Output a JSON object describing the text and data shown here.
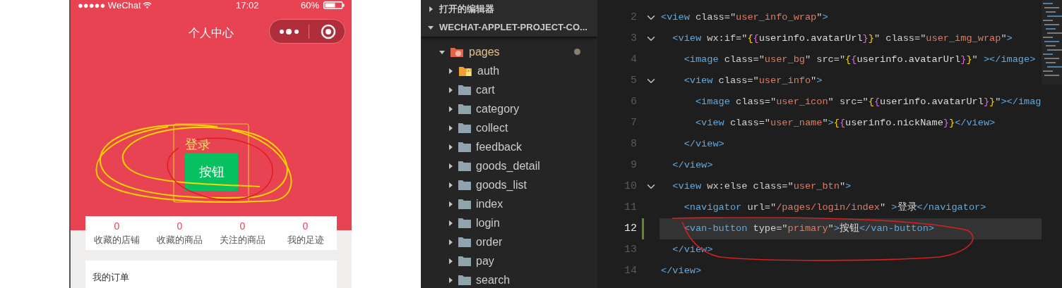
{
  "simulator": {
    "status_bar": {
      "carrier": "●●●●● WeChat",
      "time": "17:02",
      "battery": "60%"
    },
    "nav_title": "个人中心",
    "login_link": "登录",
    "button": "按钮",
    "stats": [
      {
        "value": "0",
        "label": "收藏的店铺"
      },
      {
        "value": "0",
        "label": "收藏的商品"
      },
      {
        "value": "0",
        "label": "关注的商品"
      },
      {
        "value": "0",
        "label": "我的足迹"
      }
    ],
    "orders_title": "我的订单"
  },
  "explorer": {
    "sections": [
      {
        "label": "打开的编辑器",
        "expanded": false
      },
      {
        "label": "WECHAT-APPLET-PROJECT-CO...",
        "expanded": true
      }
    ],
    "tree": [
      {
        "name": "pages",
        "kind": "special",
        "expanded": true,
        "modified": true,
        "children": [
          {
            "name": "auth",
            "kind": "locked",
            "expanded": false
          },
          {
            "name": "cart",
            "kind": "folder",
            "expanded": false
          },
          {
            "name": "category",
            "kind": "folder",
            "expanded": false
          },
          {
            "name": "collect",
            "kind": "folder",
            "expanded": false
          },
          {
            "name": "feedback",
            "kind": "folder",
            "expanded": false
          },
          {
            "name": "goods_detail",
            "kind": "folder",
            "expanded": false
          },
          {
            "name": "goods_list",
            "kind": "folder",
            "expanded": false
          },
          {
            "name": "index",
            "kind": "folder",
            "expanded": false
          },
          {
            "name": "login",
            "kind": "folder",
            "expanded": false
          },
          {
            "name": "order",
            "kind": "folder",
            "expanded": false
          },
          {
            "name": "pay",
            "kind": "folder",
            "expanded": false
          },
          {
            "name": "search",
            "kind": "folder",
            "expanded": false
          }
        ]
      }
    ]
  },
  "editor": {
    "lines": [
      {
        "number": "2",
        "foldable": true,
        "current": false,
        "tokens": [
          {
            "kind": "tag",
            "text": "<view"
          },
          {
            "kind": "attr",
            "text": " class=\""
          },
          {
            "kind": "string",
            "text": "user_info_wrap"
          },
          {
            "kind": "attr",
            "text": "\""
          },
          {
            "kind": "tag",
            "text": ">"
          }
        ]
      },
      {
        "number": "3",
        "foldable": true,
        "current": false,
        "tokens": [
          {
            "kind": "tag",
            "text": "  <view"
          },
          {
            "kind": "attr",
            "text": " wx:if=\""
          },
          {
            "kind": "brace1",
            "text": "{"
          },
          {
            "kind": "brace2",
            "text": "{"
          },
          {
            "kind": "text",
            "text": "userinfo.avatarUrl"
          },
          {
            "kind": "brace2",
            "text": "}"
          },
          {
            "kind": "brace1",
            "text": "}"
          },
          {
            "kind": "attr",
            "text": "\" class=\""
          },
          {
            "kind": "string",
            "text": "user_img_wrap"
          },
          {
            "kind": "attr",
            "text": "\""
          },
          {
            "kind": "tag",
            "text": ">"
          }
        ]
      },
      {
        "number": "4",
        "foldable": false,
        "current": false,
        "tokens": [
          {
            "kind": "tag",
            "text": "    <image"
          },
          {
            "kind": "attr",
            "text": " class=\""
          },
          {
            "kind": "string",
            "text": "user_bg"
          },
          {
            "kind": "attr",
            "text": "\" src=\""
          },
          {
            "kind": "brace1",
            "text": "{"
          },
          {
            "kind": "brace2",
            "text": "{"
          },
          {
            "kind": "text",
            "text": "userinfo.avatarUrl"
          },
          {
            "kind": "brace2",
            "text": "}"
          },
          {
            "kind": "brace1",
            "text": "}"
          },
          {
            "kind": "attr",
            "text": "\" "
          },
          {
            "kind": "tag",
            "text": "></image>"
          }
        ]
      },
      {
        "number": "5",
        "foldable": true,
        "current": false,
        "tokens": [
          {
            "kind": "tag",
            "text": "    <view"
          },
          {
            "kind": "attr",
            "text": " class=\""
          },
          {
            "kind": "string",
            "text": "user_info"
          },
          {
            "kind": "attr",
            "text": "\""
          },
          {
            "kind": "tag",
            "text": ">"
          }
        ]
      },
      {
        "number": "6",
        "foldable": false,
        "current": false,
        "tokens": [
          {
            "kind": "tag",
            "text": "      <image"
          },
          {
            "kind": "attr",
            "text": " class=\""
          },
          {
            "kind": "string",
            "text": "user_icon"
          },
          {
            "kind": "attr",
            "text": "\" src=\""
          },
          {
            "kind": "brace1",
            "text": "{"
          },
          {
            "kind": "brace2",
            "text": "{"
          },
          {
            "kind": "text",
            "text": "userinfo.avatarUrl"
          },
          {
            "kind": "brace2",
            "text": "}"
          },
          {
            "kind": "brace1",
            "text": "}"
          },
          {
            "kind": "attr",
            "text": "\""
          },
          {
            "kind": "tag",
            "text": "></imag"
          }
        ]
      },
      {
        "number": "7",
        "foldable": false,
        "current": false,
        "tokens": [
          {
            "kind": "tag",
            "text": "      <view"
          },
          {
            "kind": "attr",
            "text": " class=\""
          },
          {
            "kind": "string",
            "text": "user_name"
          },
          {
            "kind": "attr",
            "text": "\""
          },
          {
            "kind": "tag",
            "text": ">"
          },
          {
            "kind": "brace1",
            "text": "{"
          },
          {
            "kind": "brace2",
            "text": "{"
          },
          {
            "kind": "text",
            "text": "userinfo.nickName"
          },
          {
            "kind": "brace2",
            "text": "}"
          },
          {
            "kind": "brace1",
            "text": "}"
          },
          {
            "kind": "tag",
            "text": "</view>"
          }
        ]
      },
      {
        "number": "8",
        "foldable": false,
        "current": false,
        "tokens": [
          {
            "kind": "tag",
            "text": "    </view>"
          }
        ]
      },
      {
        "number": "9",
        "foldable": false,
        "current": false,
        "tokens": [
          {
            "kind": "tag",
            "text": "  </view>"
          }
        ]
      },
      {
        "number": "10",
        "foldable": true,
        "current": false,
        "tokens": [
          {
            "kind": "tag",
            "text": "  <view"
          },
          {
            "kind": "attr",
            "text": " wx:else class=\""
          },
          {
            "kind": "string",
            "text": "user_btn"
          },
          {
            "kind": "attr",
            "text": "\""
          },
          {
            "kind": "tag",
            "text": ">"
          }
        ]
      },
      {
        "number": "11",
        "foldable": false,
        "current": false,
        "tokens": [
          {
            "kind": "tag",
            "text": "    <navigator"
          },
          {
            "kind": "attr",
            "text": " url=\""
          },
          {
            "kind": "string",
            "text": "/pages/login/index"
          },
          {
            "kind": "attr",
            "text": "\" "
          },
          {
            "kind": "tag",
            "text": ">"
          },
          {
            "kind": "text",
            "text": "登录"
          },
          {
            "kind": "tag",
            "text": "</navigator>"
          }
        ]
      },
      {
        "number": "12",
        "foldable": false,
        "current": true,
        "tokens": [
          {
            "kind": "tag",
            "text": "    <van-button"
          },
          {
            "kind": "attr",
            "text": " type=\""
          },
          {
            "kind": "string",
            "text": "primary"
          },
          {
            "kind": "attr",
            "text": "\""
          },
          {
            "kind": "tag",
            "text": ">"
          },
          {
            "kind": "text",
            "text": "按钮"
          },
          {
            "kind": "tag",
            "text": "</van-button>"
          }
        ]
      },
      {
        "number": "13",
        "foldable": false,
        "current": false,
        "tokens": [
          {
            "kind": "tag",
            "text": "  </view>"
          }
        ]
      },
      {
        "number": "14",
        "foldable": false,
        "current": false,
        "tokens": [
          {
            "kind": "tag",
            "text": "</view>"
          }
        ]
      }
    ]
  }
}
